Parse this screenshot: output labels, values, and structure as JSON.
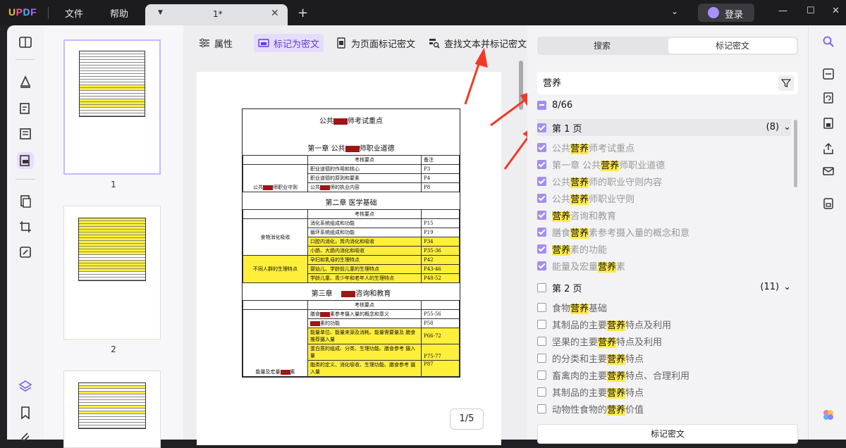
{
  "app": {
    "logo": "UPDF"
  },
  "menubar": {
    "file": "文件",
    "help": "帮助"
  },
  "tabs": [
    {
      "title": "1*",
      "close": "✕"
    }
  ],
  "new_tab": "+",
  "account": {
    "login_label": "登录"
  },
  "window": {
    "minimize": "—",
    "maximize": "☐",
    "close": "✕"
  },
  "thumbnails": [
    {
      "page_number": "1"
    },
    {
      "page_number": "2"
    }
  ],
  "toolbar": {
    "properties": "属性",
    "mark_redaction": "标记为密文",
    "mark_page_redaction": "为页面标记密文",
    "find_and_mark": "查找文本并标记密文"
  },
  "document": {
    "title_a": "公共",
    "title_b": "师考试重点",
    "ch1_a": "第一章 公共",
    "ch1_b": "师职业道德",
    "col_key": "考核要点",
    "col_note": "备注",
    "ch1_rows": [
      {
        "text": "职业道德的作用和核心",
        "page": "P3"
      },
      {
        "text": "职业道德的原则和要素",
        "page": "P4"
      },
      {
        "text_a": "公共",
        "text_b": "师的执业内容",
        "page": "P8"
      }
    ],
    "ch1_label_a": "公共",
    "ch1_label_b": "师职业守则",
    "ch2": "第二章    医学基础",
    "ch2_rows": [
      {
        "text": "消化系统组成和功能",
        "page": "P15"
      },
      {
        "text": "循环系统组成和功能",
        "page": "P19"
      },
      {
        "text": "口腔内消化，胃内消化和吸收",
        "page": "P34"
      },
      {
        "text": "小肠、大肠内消化和吸收",
        "page": "P35-36"
      },
      {
        "text": "孕妇和乳母的生理特点",
        "page": "P42"
      },
      {
        "text": "婴幼儿、学龄前儿童的生理特点",
        "page": "P43-46"
      },
      {
        "text": "学龄儿童、青少年和老年人的生理特点",
        "page": "P48-52"
      }
    ],
    "ch2_label1": "食物消化吸收",
    "ch2_label2": "不同人群的生理特点",
    "ch3_a": "第三章",
    "ch3_b": "咨询和教育",
    "ch3_rows": [
      {
        "text_a": "膳食",
        "text_b": "素参考摄入量的概念和意义",
        "page": "P55-56"
      },
      {
        "text_b": "素的功能",
        "page": "P58"
      },
      {
        "text": "能量单位、能量来源及消耗、能量需要量及 膳食推荐摄入量",
        "page": "P66-72"
      },
      {
        "text": "蛋白质的组成、分类、生理功能、膳食参考 摄入量",
        "page": "P75-77"
      },
      {
        "text": "脂类的定义、消化吸收、生理功能、膳食参考 摄入量",
        "page": "P87"
      }
    ],
    "ch3_label_a": "能量及宏量",
    "ch3_label_b": "素"
  },
  "pager": {
    "label": "1/5"
  },
  "panel": {
    "tab_search": "搜索",
    "tab_redact": "标记密文",
    "search_value": "营养",
    "total": "8/66",
    "mark_button": "标记密文"
  },
  "groups": [
    {
      "label": "第 1 页",
      "count": "(8)",
      "checked": true,
      "results": [
        {
          "pre": "公共",
          "hit": "营养",
          "post": "师考试重点"
        },
        {
          "pre": "第一章 公共",
          "hit": "营养",
          "post": "师职业道德"
        },
        {
          "pre": "公共",
          "hit": "营养",
          "post": "师的职业守则内容"
        },
        {
          "pre": "公共",
          "hit": "营养",
          "post": "师职业守则"
        },
        {
          "pre": "",
          "hit": "营养",
          "post": "咨询和教育"
        },
        {
          "pre": "膳食",
          "hit": "营养",
          "post": "素参考摄入量的概念和意"
        },
        {
          "pre": "",
          "hit": "营养",
          "post": "素的功能"
        },
        {
          "pre": "能量及宏量",
          "hit": "营养",
          "post": "素"
        }
      ]
    },
    {
      "label": "第 2 页",
      "count": "(11)",
      "checked": false,
      "results": [
        {
          "pre": "食物",
          "hit": "营养",
          "post": "基础"
        },
        {
          "pre": "其制品的主要",
          "hit": "营养",
          "post": "特点及利用"
        },
        {
          "pre": "坚果的主要",
          "hit": "营养",
          "post": "特点及利用"
        },
        {
          "pre": "的分类和主要",
          "hit": "营养",
          "post": "特点"
        },
        {
          "pre": "畜禽肉的主要",
          "hit": "营养",
          "post": "特点、合理利用"
        },
        {
          "pre": "其制品的主要",
          "hit": "营养",
          "post": "特点"
        },
        {
          "pre": "动物性食物的",
          "hit": "营养",
          "post": "价值"
        }
      ]
    }
  ],
  "colors": {
    "accent": "#a58df0",
    "highlight": "#ffe94a",
    "annotation_arrow": "#f03a26",
    "redaction_box": "#a01515"
  }
}
